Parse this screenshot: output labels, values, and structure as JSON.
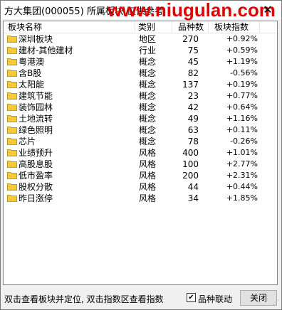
{
  "window": {
    "title": "方大集团(000055)  所属板块 仅供参考",
    "watermark": "www.niugulan.com",
    "close_glyph": "✕"
  },
  "list": {
    "columns": [
      "板块名称",
      "类别",
      "品种数",
      "板块指数"
    ],
    "rows": [
      {
        "name": "深圳板块",
        "type": "地区",
        "count": "270",
        "index": "+0.92%"
      },
      {
        "name": "建材-其他建材",
        "type": "行业",
        "count": "75",
        "index": "+0.59%"
      },
      {
        "name": "粤港澳",
        "type": "概念",
        "count": "45",
        "index": "+1.19%"
      },
      {
        "name": "含B股",
        "type": "概念",
        "count": "82",
        "index": "-0.56%"
      },
      {
        "name": "太阳能",
        "type": "概念",
        "count": "137",
        "index": "+0.19%"
      },
      {
        "name": "建筑节能",
        "type": "概念",
        "count": "23",
        "index": "+0.77%"
      },
      {
        "name": "装饰园林",
        "type": "概念",
        "count": "42",
        "index": "+0.64%"
      },
      {
        "name": "土地流转",
        "type": "概念",
        "count": "49",
        "index": "+1.16%"
      },
      {
        "name": "绿色照明",
        "type": "概念",
        "count": "63",
        "index": "+0.11%"
      },
      {
        "name": "芯片",
        "type": "概念",
        "count": "78",
        "index": "-0.26%"
      },
      {
        "name": "业绩预升",
        "type": "风格",
        "count": "400",
        "index": "+1.01%"
      },
      {
        "name": "高股息股",
        "type": "风格",
        "count": "100",
        "index": "+2.77%"
      },
      {
        "name": "低市盈率",
        "type": "风格",
        "count": "200",
        "index": "+2.31%"
      },
      {
        "name": "股权分散",
        "type": "风格",
        "count": "44",
        "index": "+0.44%"
      },
      {
        "name": "昨日涨停",
        "type": "风格",
        "count": "34",
        "index": "+1.85%"
      }
    ]
  },
  "status": {
    "hint": "双击查看板块并定位, 双击指数区查看指数",
    "checkbox_label": "品种联动",
    "checkbox_checked": true,
    "checkbox_glyph": "✔",
    "close_label": "关闭"
  },
  "colors": {
    "folder": "#f5c842",
    "folder_edge": "#c9961a",
    "watermark": "#e00000"
  },
  "icons": {
    "folder": "folder-icon",
    "close": "close-icon",
    "check": "check-icon"
  }
}
